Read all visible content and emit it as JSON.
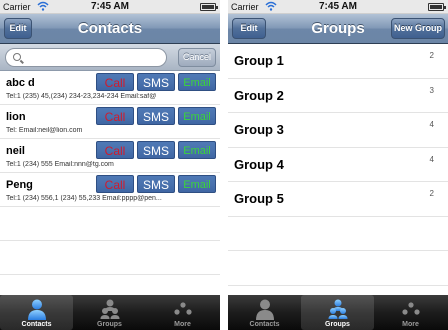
{
  "status": {
    "carrier": "Carrier",
    "time": "7:45 AM"
  },
  "contacts_screen": {
    "title": "Contacts",
    "edit_label": "Edit",
    "search": {
      "placeholder": "",
      "cancel_label": "Cancel"
    },
    "action_labels": {
      "call": "Call",
      "sms": "SMS",
      "email": "Email"
    },
    "items": [
      {
        "name": "abc d",
        "detail": "Tel:1 (235) 45,(234) 234-23,234-234   Email:saf@"
      },
      {
        "name": "lion",
        "detail": "Tel:   Email:neil@lion.com"
      },
      {
        "name": "neil",
        "detail": "Tel:1 (234) 555   Email:nnn@tg.com"
      },
      {
        "name": "Peng",
        "detail": "Tel:1 (234) 556,1 (234) 55,233   Email:pppp@pen..."
      }
    ]
  },
  "groups_screen": {
    "title": "Groups",
    "edit_label": "Edit",
    "new_group_label": "New Group",
    "items": [
      {
        "name": "Group 1",
        "count": "2"
      },
      {
        "name": "Group 2",
        "count": "3"
      },
      {
        "name": "Group 3",
        "count": "4"
      },
      {
        "name": "Group 4",
        "count": "4"
      },
      {
        "name": "Group 5",
        "count": "2"
      }
    ]
  },
  "tabs": [
    {
      "label": "Contacts",
      "icon": "person-icon"
    },
    {
      "label": "Groups",
      "icon": "group-icon"
    },
    {
      "label": "More",
      "icon": "more-icon"
    }
  ],
  "colors": {
    "nav_blue": "#6d87a8",
    "call_red": "#d01b2d",
    "email_green": "#3bd43b",
    "button_blue": "#4a72ae"
  }
}
